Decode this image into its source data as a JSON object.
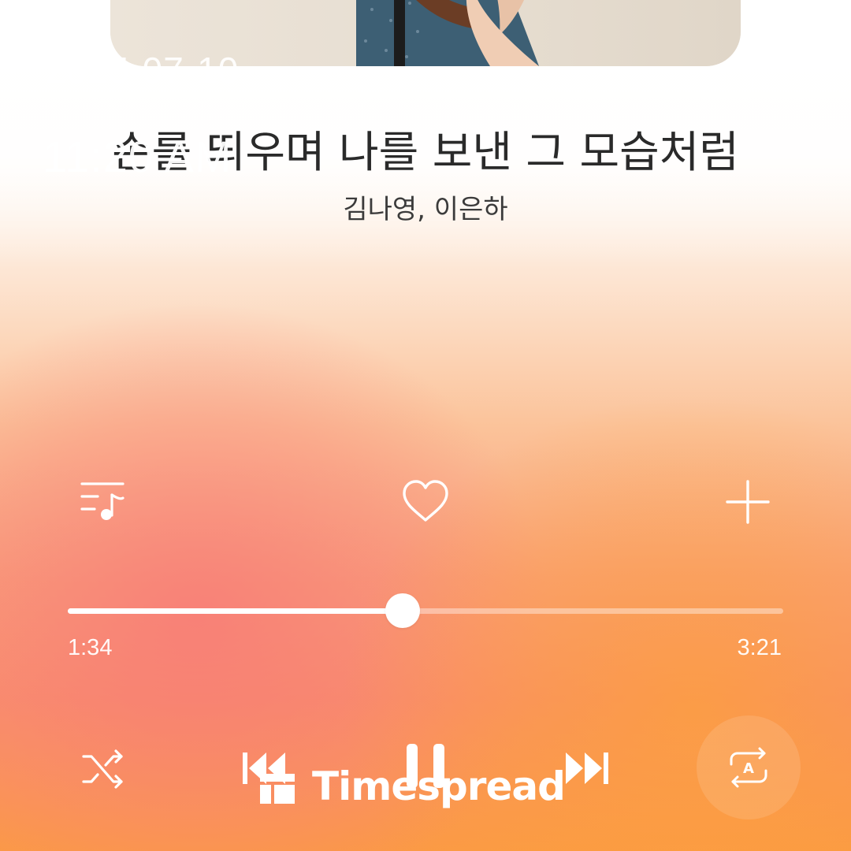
{
  "status": {
    "date": "2025-07-10",
    "time": "11:20 AM"
  },
  "song": {
    "title": "손를 띄우며 나를 보낸 그 모습처럼",
    "artist": "김나영, 이은하"
  },
  "actions": {
    "playlist_icon": "playlist-music-icon",
    "like_icon": "heart-icon",
    "add_icon": "plus-icon"
  },
  "player": {
    "elapsed": "1:34",
    "duration": "3:21",
    "progress": 0.468,
    "controls": [
      "shuffle-icon",
      "skip-previous-icon",
      "pause-icon",
      "skip-next-icon",
      "repeat-all-icon"
    ]
  },
  "watermark": {
    "text": "Timespread"
  },
  "colors": {
    "accent": "#ffffff",
    "title": "#2a2a2a",
    "gradient_top": "#ffffff",
    "gradient_bottom_left": "#f98a78",
    "gradient_bottom_right": "#fb9a45"
  }
}
